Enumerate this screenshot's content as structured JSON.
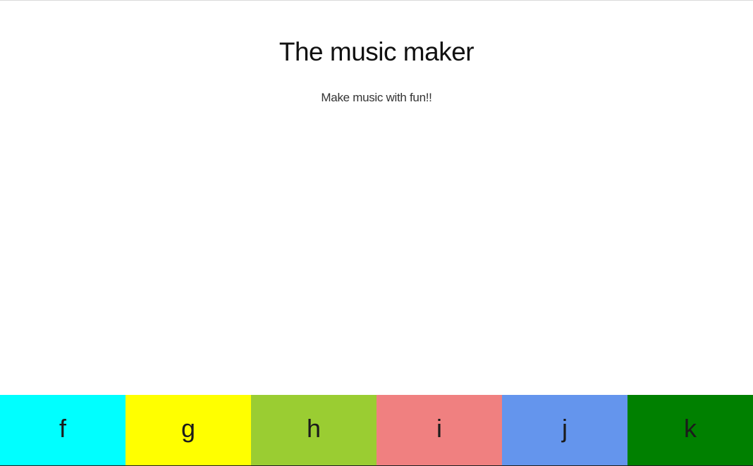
{
  "header": {
    "title": "The music maker",
    "subtitle": "Make music with fun!!"
  },
  "keys": [
    {
      "label": "f",
      "color": "#00ffff"
    },
    {
      "label": "g",
      "color": "#ffff00"
    },
    {
      "label": "h",
      "color": "#9acd32"
    },
    {
      "label": "i",
      "color": "#f08080"
    },
    {
      "label": "j",
      "color": "#6495ed"
    },
    {
      "label": "k",
      "color": "#008000"
    }
  ]
}
